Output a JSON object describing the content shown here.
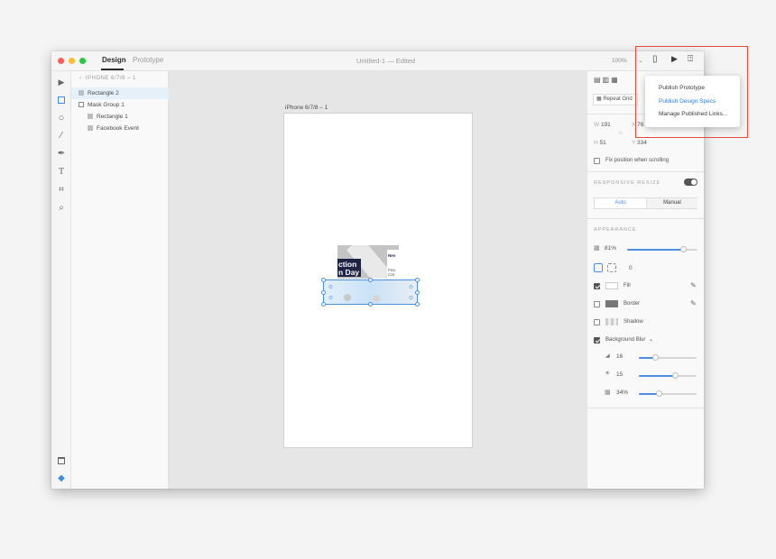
{
  "window": {
    "tabs": [
      "Design",
      "Prototype"
    ],
    "title": "Untitled-1 — Edited",
    "zoom": "100%"
  },
  "layers": {
    "breadcrumb": "IPHONE 6/7/8 – 1",
    "items": [
      "Rectangle 2",
      "Mask Group 1",
      "Rectangle 1",
      "Facebook Event"
    ]
  },
  "canvas": {
    "artboard_label": "iPhone 6/7/8 – 1",
    "image_text": [
      "ction",
      "n Day",
      "Nev",
      "Fea",
      "Cat"
    ]
  },
  "properties": {
    "repeat_grid": "Repeat Grid",
    "w_label": "W",
    "w_value": "191",
    "x_label": "X",
    "x_value": "76",
    "h_label": "H",
    "h_value": "51",
    "y_label": "Y",
    "y_value": "334",
    "fix_position": "Fix position when scrolling",
    "responsive_title": "RESPONSIVE RESIZE",
    "auto": "Auto",
    "manual": "Manual",
    "appearance_title": "APPEARANCE",
    "opacity": "81%",
    "opacity_level": 0.81,
    "radius": "0",
    "fill": "Fill",
    "border": "Border",
    "shadow": "Shadow",
    "background_blur": "Background Blur",
    "blur_amount": "16",
    "blur_brightness": "15",
    "blur_opacity": "34%"
  },
  "menu": {
    "items": [
      "Publish Prototype",
      "Publish Design Specs",
      "Manage Published Links..."
    ]
  },
  "colors": {
    "accent": "#4b8fe3",
    "highlight": "#e4493a",
    "selection": "#4b8fe3"
  },
  "icons": [
    "select-icon",
    "rectangle-icon",
    "ellipse-icon",
    "line-icon",
    "pen-icon",
    "text-icon",
    "artboard-icon",
    "zoom-icon",
    "assets-icon",
    "layers-icon",
    "device-icon",
    "play-icon",
    "share-icon",
    "eyedropper-icon"
  ]
}
